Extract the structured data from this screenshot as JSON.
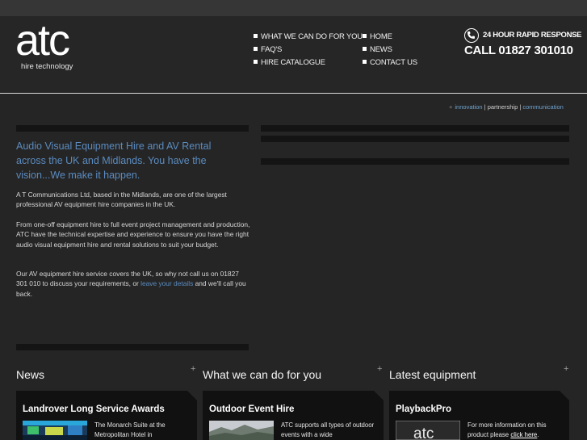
{
  "brand": {
    "logo_text": "atc",
    "logo_subtitle": "hire technology"
  },
  "nav": {
    "col1": [
      "WHAT WE CAN DO FOR YOU",
      "FAQ'S",
      "HIRE CATALOGUE"
    ],
    "col2": [
      "HOME",
      "NEWS",
      "CONTACT US"
    ]
  },
  "phone": {
    "tagline": "24 HOUR RAPID RESPONSE",
    "number": "CALL 01827 301010"
  },
  "tagline": {
    "plus": "+",
    "part1": "innovation",
    "sep1": " | ",
    "part2": "partnership",
    "sep2": " | ",
    "part3": "communication"
  },
  "intro": {
    "title": "Audio Visual Equipment Hire and AV Rental across the UK and Midlands. You have the vision...We make it happen.",
    "para1": "A T Communications Ltd, based in the Midlands, are one of the largest professional AV equipment hire companies in the UK.",
    "para2": "From one-off equipment hire to full event project management and production, ATC have the technical expertise and experience to ensure you have the right audio visual equipment hire and rental solutions to suit your budget.",
    "para3_before": "Our AV equipment hire service covers the UK, so why not call us on 01827 301 010 to discuss your requirements, or ",
    "para3_link": "leave your details",
    "para3_after": " and we'll call you back."
  },
  "sections": [
    {
      "title": "News",
      "plus": "+",
      "box_title": "Landrover Long Service Awards",
      "text_a": "The Monarch Suite at the Metropolitan Hotel in",
      "text_link": "",
      "text_b": ""
    },
    {
      "title": "What we can do for you",
      "plus": "+",
      "box_title": "Outdoor Event Hire",
      "text_a": "ATC supports all types of outdoor events with a wide",
      "text_link": "",
      "text_b": ""
    },
    {
      "title": "Latest equipment",
      "plus": "+",
      "box_title": "PlaybackPro",
      "text_a": "For more information on this product please ",
      "text_link": "click here",
      "text_b": "."
    }
  ],
  "colors": {
    "accent_blue": "#5b8bbf",
    "background": "#252525",
    "box": "#111111"
  }
}
